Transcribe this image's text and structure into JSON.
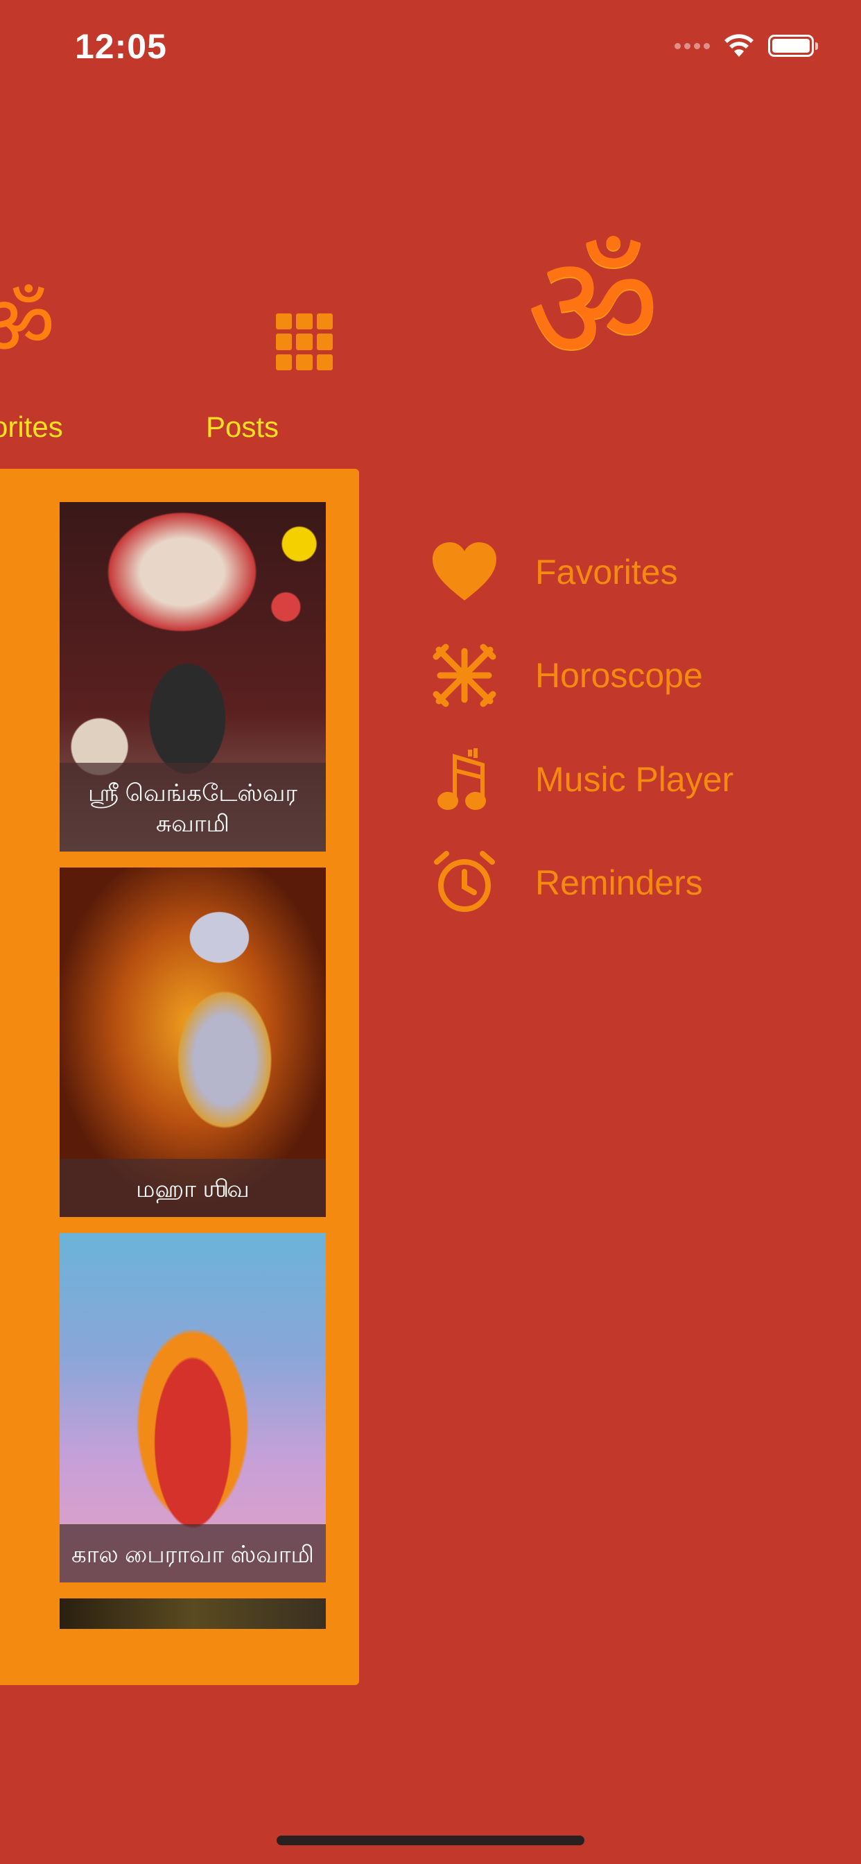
{
  "status_bar": {
    "time": "12:05",
    "icons": [
      "cellular-dots-icon",
      "wifi-icon",
      "battery-icon"
    ]
  },
  "tab_bar": {
    "items": [
      {
        "label": "orites",
        "icon": "om-icon"
      },
      {
        "label": "Posts",
        "icon": "grid-icon"
      }
    ]
  },
  "posts": [
    {
      "caption": "ஸ்ரீ வெங்கடேஸ்வர சுவாமி"
    },
    {
      "caption": "மஹா ஶிவ"
    },
    {
      "caption": "கால பைராவா ஸ்வாமி"
    }
  ],
  "side_menu": {
    "logo_icon": "om-logo-icon",
    "items": [
      {
        "label": "Favorites",
        "icon": "heart-icon"
      },
      {
        "label": "Horoscope",
        "icon": "horoscope-icon"
      },
      {
        "label": "Music Player",
        "icon": "music-note-icon"
      },
      {
        "label": "Reminders",
        "icon": "alarm-clock-icon"
      }
    ]
  },
  "colors": {
    "background": "#c2382b",
    "accent_orange": "#f58a10",
    "tab_label_yellow": "#ffe21f",
    "om_orange": "#ff7412"
  }
}
